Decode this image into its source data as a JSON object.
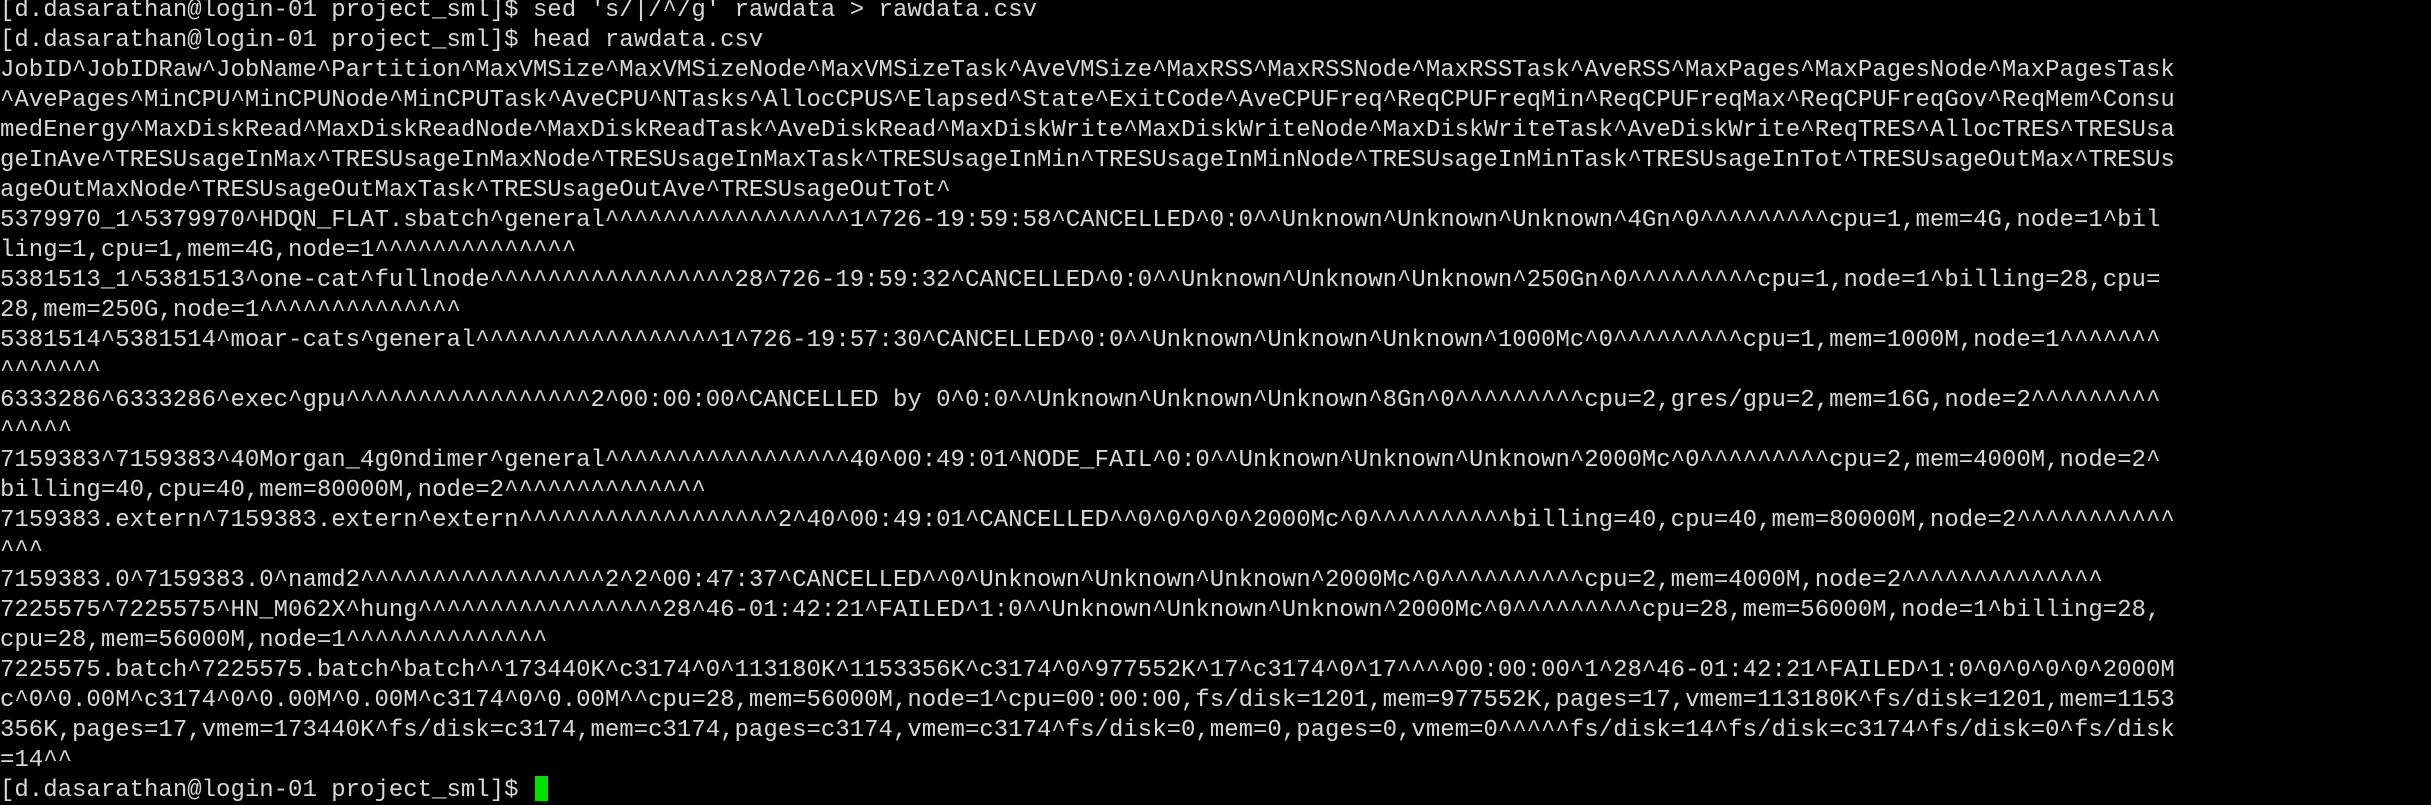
{
  "terminal": {
    "colors": {
      "background": "#000000",
      "text": "#d7d7d7",
      "cursor": "#00e000"
    },
    "lines": [
      "[d.dasarathan@login-01 project_sml]$ sed 's/|/^/g' rawdata > rawdata.csv",
      "[d.dasarathan@login-01 project_sml]$ head rawdata.csv",
      "JobID^JobIDRaw^JobName^Partition^MaxVMSize^MaxVMSizeNode^MaxVMSizeTask^AveVMSize^MaxRSS^MaxRSSNode^MaxRSSTask^AveRSS^MaxPages^MaxPagesNode^MaxPagesTask",
      "^AvePages^MinCPU^MinCPUNode^MinCPUTask^AveCPU^NTasks^AllocCPUS^Elapsed^State^ExitCode^AveCPUFreq^ReqCPUFreqMin^ReqCPUFreqMax^ReqCPUFreqGov^ReqMem^Consu",
      "medEnergy^MaxDiskRead^MaxDiskReadNode^MaxDiskReadTask^AveDiskRead^MaxDiskWrite^MaxDiskWriteNode^MaxDiskWriteTask^AveDiskWrite^ReqTRES^AllocTRES^TRESUsa",
      "geInAve^TRESUsageInMax^TRESUsageInMaxNode^TRESUsageInMaxTask^TRESUsageInMin^TRESUsageInMinNode^TRESUsageInMinTask^TRESUsageInTot^TRESUsageOutMax^TRESUs",
      "ageOutMaxNode^TRESUsageOutMaxTask^TRESUsageOutAve^TRESUsageOutTot^",
      "5379970_1^5379970^HDQN_FLAT.sbatch^general^^^^^^^^^^^^^^^^^1^726-19:59:58^CANCELLED^0:0^^Unknown^Unknown^Unknown^4Gn^0^^^^^^^^^cpu=1,mem=4G,node=1^bil",
      "ling=1,cpu=1,mem=4G,node=1^^^^^^^^^^^^^^",
      "5381513_1^5381513^one-cat^fullnode^^^^^^^^^^^^^^^^^28^726-19:59:32^CANCELLED^0:0^^Unknown^Unknown^Unknown^250Gn^0^^^^^^^^^cpu=1,node=1^billing=28,cpu=",
      "28,mem=250G,node=1^^^^^^^^^^^^^^",
      "5381514^5381514^moar-cats^general^^^^^^^^^^^^^^^^^1^726-19:57:30^CANCELLED^0:0^^Unknown^Unknown^Unknown^1000Mc^0^^^^^^^^^cpu=1,mem=1000M,node=1^^^^^^^",
      "^^^^^^^",
      "6333286^6333286^exec^gpu^^^^^^^^^^^^^^^^^2^00:00:00^CANCELLED by 0^0:0^^Unknown^Unknown^Unknown^8Gn^0^^^^^^^^^cpu=2,gres/gpu=2,mem=16G,node=2^^^^^^^^^",
      "^^^^^",
      "7159383^7159383^40Morgan_4g0ndimer^general^^^^^^^^^^^^^^^^^40^00:49:01^NODE_FAIL^0:0^^Unknown^Unknown^Unknown^2000Mc^0^^^^^^^^^cpu=2,mem=4000M,node=2^",
      "billing=40,cpu=40,mem=80000M,node=2^^^^^^^^^^^^^^",
      "7159383.extern^7159383.extern^extern^^^^^^^^^^^^^^^^^^2^40^00:49:01^CANCELLED^^0^0^0^0^2000Mc^0^^^^^^^^^^billing=40,cpu=40,mem=80000M,node=2^^^^^^^^^^^",
      "^^^",
      "7159383.0^7159383.0^namd2^^^^^^^^^^^^^^^^^2^2^00:47:37^CANCELLED^^0^Unknown^Unknown^Unknown^2000Mc^0^^^^^^^^^^cpu=2,mem=4000M,node=2^^^^^^^^^^^^^^",
      "7225575^7225575^HN_M062X^hung^^^^^^^^^^^^^^^^^28^46-01:42:21^FAILED^1:0^^Unknown^Unknown^Unknown^2000Mc^0^^^^^^^^^cpu=28,mem=56000M,node=1^billing=28,",
      "cpu=28,mem=56000M,node=1^^^^^^^^^^^^^^",
      "7225575.batch^7225575.batch^batch^^173440K^c3174^0^113180K^1153356K^c3174^0^977552K^17^c3174^0^17^^^^00:00:00^1^28^46-01:42:21^FAILED^1:0^0^0^0^0^2000M",
      "c^0^0.00M^c3174^0^0.00M^0.00M^c3174^0^0.00M^^cpu=28,mem=56000M,node=1^cpu=00:00:00,fs/disk=1201,mem=977552K,pages=17,vmem=113180K^fs/disk=1201,mem=1153",
      "356K,pages=17,vmem=173440K^fs/disk=c3174,mem=c3174,pages=c3174,vmem=c3174^fs/disk=0,mem=0,pages=0,vmem=0^^^^^fs/disk=14^fs/disk=c3174^fs/disk=0^fs/disk",
      "=14^^",
      "[d.dasarathan@login-01 project_sml]$ "
    ]
  }
}
